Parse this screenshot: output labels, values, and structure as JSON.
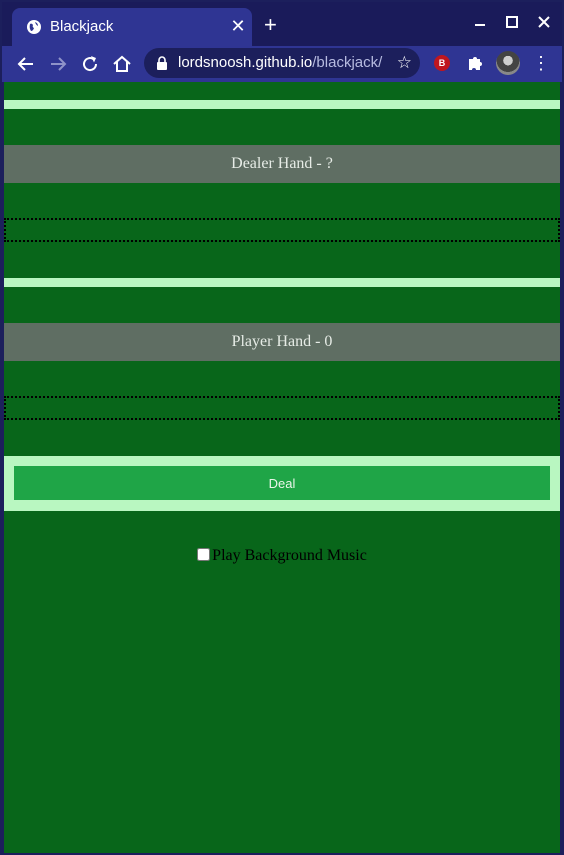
{
  "browser": {
    "tab_title": "Blackjack",
    "tab_close": "✕",
    "new_tab": "+",
    "url_host": "lordsnoosh.github.io",
    "url_path": "/blackjack/",
    "extension_badge": "B"
  },
  "game": {
    "dealer_label": "Dealer Hand - ?",
    "player_label": "Player Hand - 0",
    "deal_button": "Deal",
    "music_label": "Play Background Music",
    "music_checked": false
  },
  "colors": {
    "felt": "#08661a",
    "stripe": "#b9f7c1",
    "label_bg": "#5f6e63",
    "button": "#1fa547",
    "chrome": "#2f3593"
  }
}
